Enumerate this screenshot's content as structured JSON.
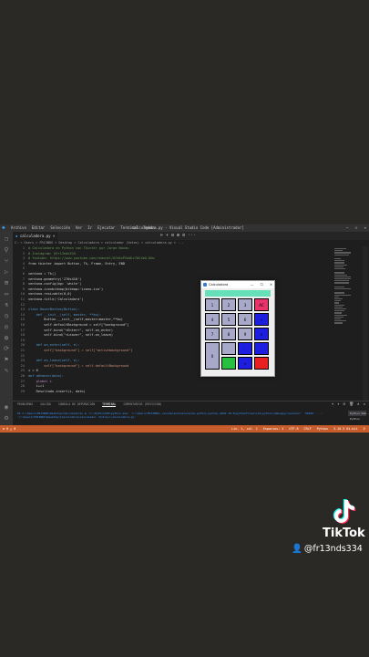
{
  "titlebar": {
    "menu": [
      "Archivo",
      "Editar",
      "Selección",
      "Ver",
      "Ir",
      "Ejecutar",
      "Terminal",
      "Ayuda"
    ],
    "window_title": "calculadora.py - Visual Studio Code [Administrador]",
    "buttons": [
      "—",
      "❐",
      "✕"
    ]
  },
  "tab": {
    "label": "calculadora.py",
    "close": "×"
  },
  "toolbar": [
    "⊳",
    "▾",
    "⊟",
    "⊞",
    "⊡",
    "···"
  ],
  "breadcrumb": "C: > Users > FR13NDS > Desktop > Calculadora > calculador (Votos) > calculadora.py > ...",
  "code": [
    {
      "n": "1",
      "t": "# Calculadora en Python con Tkinter por Jorge Navas",
      "c": "#6a9955"
    },
    {
      "n": "2",
      "t": "# Instagram: @fr13nds334",
      "c": "#6a9955"
    },
    {
      "n": "3",
      "t": "# Youtube: https://www.youtube.com/channel/UCm5vP2oWLz7bCzbQ-DXw",
      "c": "#6a9955"
    },
    {
      "n": "4",
      "t": "from tkinter import Button, Tk, Frame, Entry, END",
      "c": "#d4d4d4"
    },
    {
      "n": "5",
      "t": "",
      "c": "#d4d4d4"
    },
    {
      "n": "6",
      "t": "ventana = Tk()",
      "c": "#d4d4d4"
    },
    {
      "n": "7",
      "t": "ventana.geometry('270x410')",
      "c": "#d4d4d4"
    },
    {
      "n": "8",
      "t": "ventana.config(bg= 'white')",
      "c": "#d4d4d4"
    },
    {
      "n": "9",
      "t": "ventana.iconbitmap(bitmap='icono.ico')",
      "c": "#d4d4d4"
    },
    {
      "n": "10",
      "t": "ventana.resizable(0,0)",
      "c": "#d4d4d4"
    },
    {
      "n": "11",
      "t": "ventana.title('Calculadora')",
      "c": "#d4d4d4"
    },
    {
      "n": "12",
      "t": "",
      "c": "#d4d4d4"
    },
    {
      "n": "13",
      "t": "class HoverButton(Button):",
      "c": "#569cd6"
    },
    {
      "n": "14",
      "t": "    def __init__(self, master, **kw):",
      "c": "#569cd6"
    },
    {
      "n": "15",
      "t": "        Button.__init__(self,master=master,**kw)",
      "c": "#d4d4d4"
    },
    {
      "n": "16",
      "t": "        self.defaultBackground = self[\"background\"]",
      "c": "#d4d4d4"
    },
    {
      "n": "17",
      "t": "        self.bind(\"<Enter>\", self.on_enter)",
      "c": "#d4d4d4"
    },
    {
      "n": "18",
      "t": "        self.bind(\"<Leave>\", self.on_leave)",
      "c": "#d4d4d4"
    },
    {
      "n": "19",
      "t": "",
      "c": "#d4d4d4"
    },
    {
      "n": "20",
      "t": "    def on_enter(self, e):",
      "c": "#569cd6"
    },
    {
      "n": "21",
      "t": "        self[\"background\"] = self[\"activebackground\"]",
      "c": "#ce9178"
    },
    {
      "n": "22",
      "t": "",
      "c": "#d4d4d4"
    },
    {
      "n": "23",
      "t": "    def on_leave(self, e):",
      "c": "#569cd6"
    },
    {
      "n": "24",
      "t": "        self[\"background\"] = self.defaultBackground",
      "c": "#ce9178"
    },
    {
      "n": "25",
      "t": "i = 0",
      "c": "#d4d4d4"
    },
    {
      "n": "26",
      "t": "def obtener(dato):",
      "c": "#569cd6"
    },
    {
      "n": "27",
      "t": "    global i",
      "c": "#c586c0"
    },
    {
      "n": "28",
      "t": "    i+=1",
      "c": "#d4d4d4"
    },
    {
      "n": "29",
      "t": "    Resultado.insert(i, dato)",
      "c": "#d4d4d4"
    }
  ],
  "panel": {
    "tabs": [
      "PROBLEMAS",
      "SALIDA",
      "CONSOLA DE DEPURACIÓN",
      "TERMINAL",
      "COMENTARIOS (REVISIÓN)"
    ],
    "active_tab": "TERMINAL",
    "right": [
      "+",
      "▾",
      "⊟",
      "🗑",
      "∧",
      "✕"
    ],
    "terminal_lines": [
      "PS C:\\Users\\FR13NDS\\Desktop\\Calculadora> & 'C:\\Python310\\python.exe' 'c:\\Users\\FR13NDS\\.vscode\\extensions\\ms-python.python-2022.10.0\\pythonFiles\\lib\\python\\debugpy\\launcher' '50644' '--' ",
      "'c:\\Users\\FR13NDS\\Desktop\\Calculadora\\calculador (Votos)\\calculadora.py'"
    ],
    "terminal_list": [
      "Python Deb...",
      "Python"
    ]
  },
  "statusbar": {
    "left": "⊗ 0 △ 0",
    "right": [
      "Lín. 1, col. 1",
      "Espacios: 4",
      "UTF-8",
      "CRLF",
      "Python",
      "3.10.5 64-bit",
      "⚲"
    ]
  },
  "calculator": {
    "title": "Calculadora",
    "title_buttons": [
      "—",
      "☐",
      "✕"
    ],
    "display_color": "#66e0b8",
    "keys": [
      {
        "label": "1",
        "color": "#a8a8c8"
      },
      {
        "label": "2",
        "color": "#a8a8c8"
      },
      {
        "label": "3",
        "color": "#a8a8c8"
      },
      {
        "label": "AC",
        "color": "#e8336b"
      },
      {
        "label": "4",
        "color": "#a8a8c8"
      },
      {
        "label": "5",
        "color": "#a8a8c8"
      },
      {
        "label": "6",
        "color": "#a8a8c8"
      },
      {
        "label": "÷",
        "color": "#1e1ee0"
      },
      {
        "label": "7",
        "color": "#a8a8c8"
      },
      {
        "label": "8",
        "color": "#a8a8c8"
      },
      {
        "label": "9",
        "color": "#a8a8c8"
      },
      {
        "label": "×",
        "color": "#1e1ee0"
      },
      {
        "label": "0",
        "color": "#a8a8c8"
      },
      {
        "label": "",
        "color": "#a8a8c8"
      },
      {
        "label": "-",
        "color": "#1e1ee0"
      },
      {
        "label": "",
        "color": "#1e1ee0"
      },
      {
        "label": "",
        "color": "#28c040"
      },
      {
        "label": "+",
        "color": "#1e1ee0"
      },
      {
        "label": "",
        "color": "#e82020"
      }
    ]
  },
  "branding": {
    "app": "TikTok",
    "handle": "@fr13nds334"
  }
}
